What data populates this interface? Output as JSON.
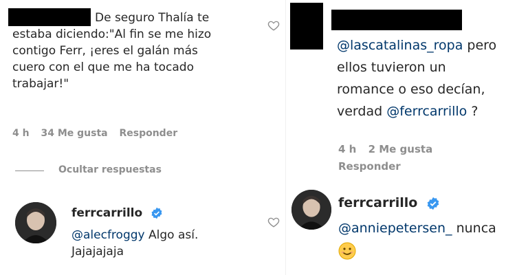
{
  "left": {
    "comment": {
      "text": "De seguro Thalía te estaba diciendo:\"Al fin se me hizo contigo Ferr, ¡eres el galán más cuero con el que me ha tocado trabajar!\"",
      "line1": "De seguro Thalía te",
      "line2": "estaba diciendo:\"Al fin se me hizo",
      "line3": "contigo Ferr, ¡eres el galán más",
      "line4": "cuero con el que me ha tocado",
      "line5": "trabajar!\"",
      "time": "4 h",
      "likes": "34 Me gusta",
      "reply": "Responder"
    },
    "hide_replies": "Ocultar respuestas",
    "reply": {
      "username": "ferrcarrillo",
      "mention": "@alecfroggy",
      "text": " Algo así.",
      "line2": "Jajajajaja"
    }
  },
  "right": {
    "comment": {
      "mention1": "@lascatalinas_ropa",
      "line1_rest": " pero",
      "line2": "ellos tuvieron un",
      "line3": "romance o eso decían,",
      "line4_pre": "verdad ",
      "mention2": "@ferrcarrillo",
      "line4_post": " ?",
      "time": "4 h",
      "likes": "2 Me gusta",
      "reply": "Responder"
    },
    "reply": {
      "username": "ferrcarrillo",
      "mention": "@anniepetersen_",
      "text": " nunca"
    }
  },
  "icons": {
    "heart": "heart-outline-icon",
    "verified": "verified-badge-icon",
    "emoji": "smiling-face-emoji"
  },
  "colors": {
    "mention": "#00376b",
    "meta": "#8e8e8e",
    "verified": "#3897f0"
  }
}
